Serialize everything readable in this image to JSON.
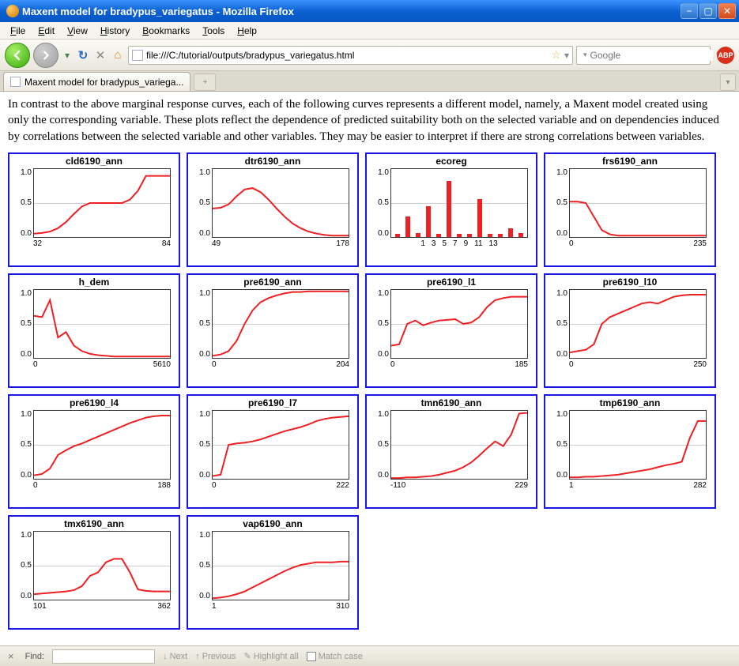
{
  "window": {
    "title": "Maxent model for bradypus_variegatus - Mozilla Firefox"
  },
  "menu": [
    "File",
    "Edit",
    "View",
    "History",
    "Bookmarks",
    "Tools",
    "Help"
  ],
  "url": "file:///C:/tutorial/outputs/bradypus_variegatus.html",
  "search_placeholder": "Google",
  "tab_title": "Maxent model for bradypus_variega...",
  "paragraph": "In contrast to the above marginal response curves, each of the following curves represents a different model, namely, a Maxent model created using only the corresponding variable. These plots reflect the dependence of predicted suitability both on the selected variable and on dependencies induced by correlations between the selected variable and other variables. They may be easier to interpret if there are strong correlations between variables.",
  "find": {
    "label": "Find:",
    "next": "Next",
    "previous": "Previous",
    "highlight": "Highlight all",
    "matchcase": "Match case"
  },
  "chart_data": [
    {
      "type": "line",
      "title": "cld6190_ann",
      "xticks": [
        "32",
        "84"
      ],
      "ylim": [
        0,
        1
      ],
      "values": [
        0.05,
        0.06,
        0.08,
        0.13,
        0.22,
        0.34,
        0.45,
        0.5,
        0.5,
        0.5,
        0.5,
        0.5,
        0.55,
        0.68,
        0.9,
        0.9,
        0.9,
        0.9
      ]
    },
    {
      "type": "line",
      "title": "dtr6190_ann",
      "xticks": [
        "49",
        "178"
      ],
      "ylim": [
        0,
        1
      ],
      "values": [
        0.42,
        0.43,
        0.48,
        0.6,
        0.7,
        0.72,
        0.66,
        0.55,
        0.42,
        0.3,
        0.2,
        0.13,
        0.08,
        0.05,
        0.03,
        0.02,
        0.02,
        0.02
      ]
    },
    {
      "type": "bar",
      "title": "ecoreg",
      "xticks": [
        "1",
        "3",
        "5",
        "7",
        "9",
        "11",
        "13"
      ],
      "ylim": [
        0,
        1
      ],
      "categories": [
        "1",
        "2",
        "3",
        "4",
        "5",
        "6",
        "7",
        "8",
        "9",
        "10",
        "11",
        "12",
        "13"
      ],
      "values": [
        0.04,
        0.3,
        0.05,
        0.45,
        0.04,
        0.82,
        0.04,
        0.04,
        0.55,
        0.04,
        0.04,
        0.12,
        0.05
      ]
    },
    {
      "type": "line",
      "title": "frs6190_ann",
      "xticks": [
        "0",
        "235"
      ],
      "ylim": [
        0,
        1
      ],
      "values": [
        0.52,
        0.52,
        0.5,
        0.3,
        0.1,
        0.04,
        0.02,
        0.02,
        0.02,
        0.02,
        0.02,
        0.02,
        0.02,
        0.02,
        0.02,
        0.02,
        0.02,
        0.02
      ]
    },
    {
      "type": "line",
      "title": "h_dem",
      "xticks": [
        "0",
        "5610"
      ],
      "ylim": [
        0,
        1
      ],
      "values": [
        0.62,
        0.6,
        0.85,
        0.3,
        0.38,
        0.18,
        0.1,
        0.06,
        0.04,
        0.03,
        0.02,
        0.02,
        0.02,
        0.02,
        0.02,
        0.02,
        0.02,
        0.02
      ]
    },
    {
      "type": "line",
      "title": "pre6190_ann",
      "xticks": [
        "0",
        "204"
      ],
      "ylim": [
        0,
        1
      ],
      "values": [
        0.03,
        0.05,
        0.1,
        0.25,
        0.5,
        0.7,
        0.82,
        0.88,
        0.92,
        0.95,
        0.97,
        0.97,
        0.98,
        0.98,
        0.98,
        0.98,
        0.98,
        0.98
      ]
    },
    {
      "type": "line",
      "title": "pre6190_l1",
      "xticks": [
        "0",
        "185"
      ],
      "ylim": [
        0,
        1
      ],
      "values": [
        0.18,
        0.2,
        0.5,
        0.55,
        0.48,
        0.52,
        0.55,
        0.56,
        0.57,
        0.5,
        0.52,
        0.6,
        0.75,
        0.85,
        0.88,
        0.9,
        0.9,
        0.9
      ]
    },
    {
      "type": "line",
      "title": "pre6190_l10",
      "xticks": [
        "0",
        "250"
      ],
      "ylim": [
        0,
        1
      ],
      "values": [
        0.08,
        0.1,
        0.12,
        0.2,
        0.5,
        0.6,
        0.65,
        0.7,
        0.75,
        0.8,
        0.82,
        0.8,
        0.85,
        0.9,
        0.92,
        0.93,
        0.93,
        0.93
      ]
    },
    {
      "type": "line",
      "title": "pre6190_l4",
      "xticks": [
        "0",
        "188"
      ],
      "ylim": [
        0,
        1
      ],
      "values": [
        0.05,
        0.07,
        0.15,
        0.35,
        0.42,
        0.48,
        0.52,
        0.57,
        0.62,
        0.67,
        0.72,
        0.77,
        0.82,
        0.86,
        0.9,
        0.92,
        0.93,
        0.93
      ]
    },
    {
      "type": "line",
      "title": "pre6190_l7",
      "xticks": [
        "0",
        "222"
      ],
      "ylim": [
        0,
        1
      ],
      "values": [
        0.04,
        0.06,
        0.5,
        0.52,
        0.53,
        0.55,
        0.58,
        0.62,
        0.66,
        0.7,
        0.73,
        0.76,
        0.8,
        0.85,
        0.88,
        0.9,
        0.91,
        0.92
      ]
    },
    {
      "type": "line",
      "title": "tmn6190_ann",
      "xticks": [
        "-110",
        "229"
      ],
      "ylim": [
        0,
        1
      ],
      "values": [
        0.01,
        0.01,
        0.02,
        0.02,
        0.03,
        0.04,
        0.06,
        0.09,
        0.12,
        0.17,
        0.24,
        0.34,
        0.45,
        0.55,
        0.48,
        0.65,
        0.96,
        0.97
      ]
    },
    {
      "type": "line",
      "title": "tmp6190_ann",
      "xticks": [
        "1",
        "282"
      ],
      "ylim": [
        0,
        1
      ],
      "values": [
        0.02,
        0.02,
        0.03,
        0.03,
        0.04,
        0.05,
        0.06,
        0.08,
        0.1,
        0.12,
        0.14,
        0.17,
        0.2,
        0.22,
        0.25,
        0.6,
        0.85,
        0.85
      ]
    },
    {
      "type": "line",
      "title": "tmx6190_ann",
      "xticks": [
        "101",
        "362"
      ],
      "ylim": [
        0,
        1
      ],
      "values": [
        0.08,
        0.09,
        0.1,
        0.11,
        0.12,
        0.14,
        0.2,
        0.35,
        0.4,
        0.55,
        0.6,
        0.6,
        0.4,
        0.15,
        0.13,
        0.12,
        0.12,
        0.12
      ]
    },
    {
      "type": "line",
      "title": "vap6190_ann",
      "xticks": [
        "1",
        "310"
      ],
      "ylim": [
        0,
        1
      ],
      "values": [
        0.02,
        0.03,
        0.05,
        0.08,
        0.12,
        0.18,
        0.24,
        0.3,
        0.36,
        0.42,
        0.47,
        0.51,
        0.53,
        0.55,
        0.55,
        0.55,
        0.56,
        0.56
      ]
    }
  ]
}
